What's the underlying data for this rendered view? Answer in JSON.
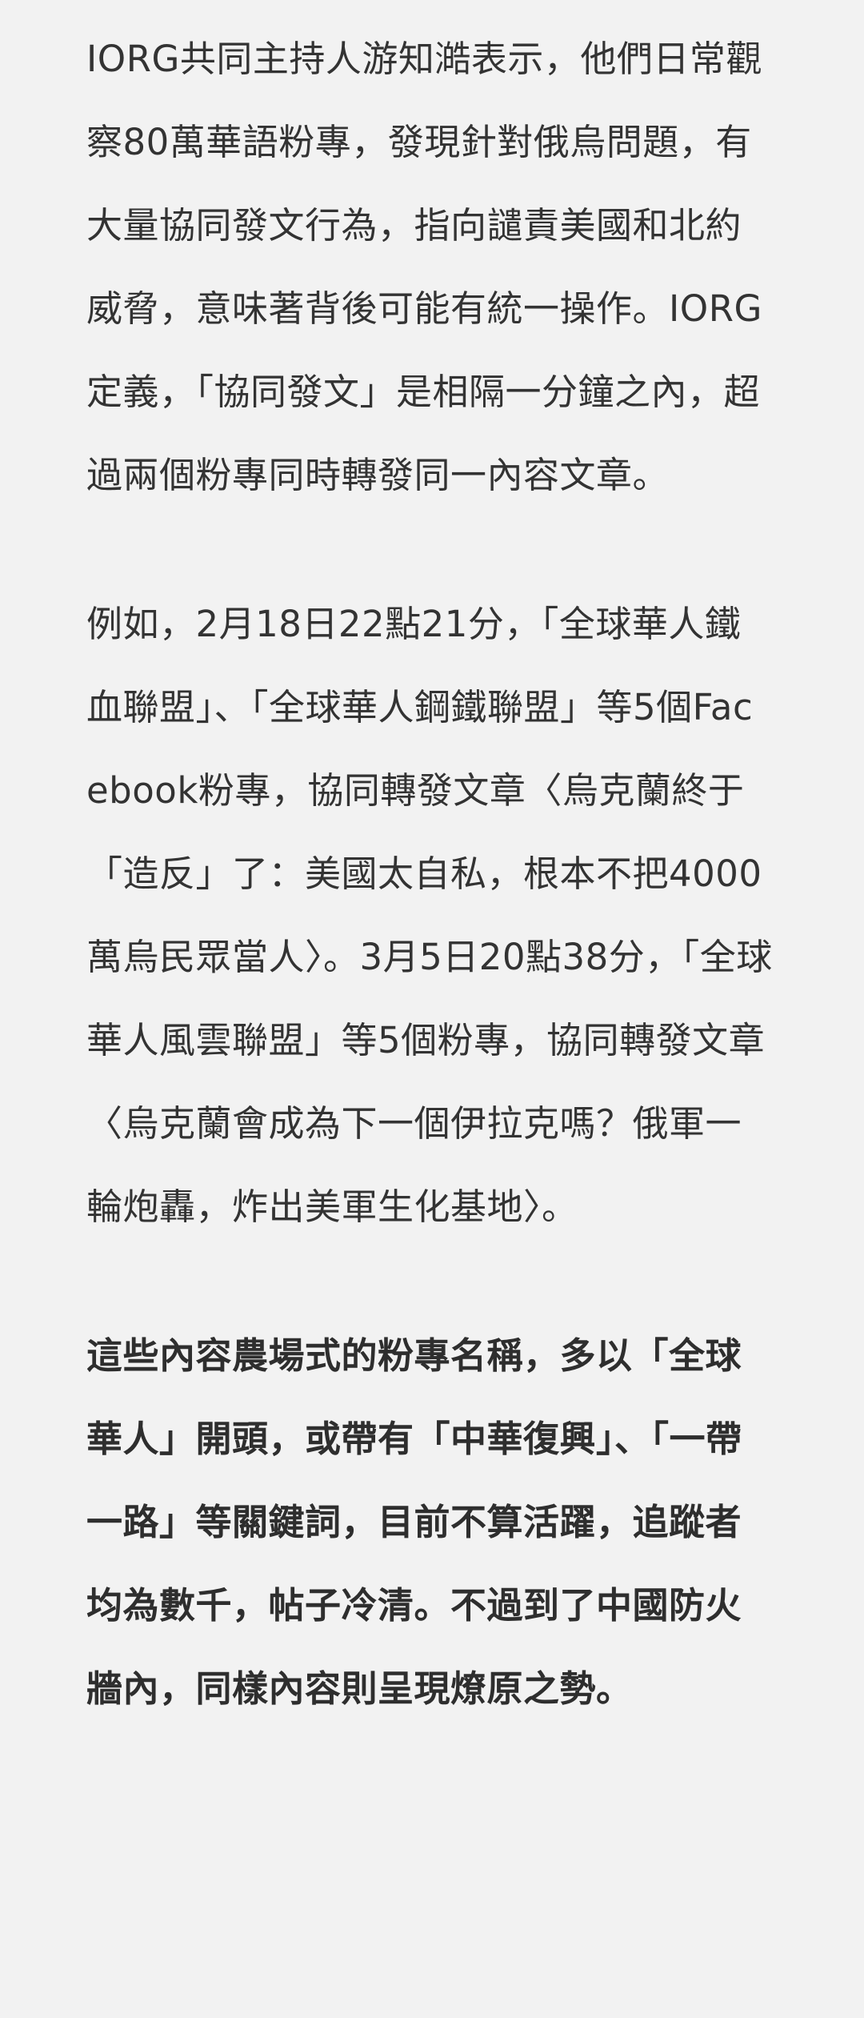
{
  "article": {
    "paragraphs": [
      {
        "text": "IORG共同主持人游知澔表示，他們日常觀察80萬華語粉專，發現針對俄烏問題，有大量協同發文行為，指向譴責美國和北約威脅，意味著背後可能有統一操作。IORG定義，「協同發文」是相隔一分鐘之內，超過兩個粉專同時轉發同一內容文章。"
      },
      {
        "text": "例如，2月18日22點21分，「全球華人鐵血聯盟」、「全球華人鋼鐵聯盟」等5個Facebook粉專，協同轉發文章〈烏克蘭終于「造反」了：美國太自私，根本不把4000萬烏民眾當人〉。3月5日20點38分，「全球華人風雲聯盟」等5個粉專，協同轉發文章〈烏克蘭會成為下一個伊拉克嗎？俄軍一輪炮轟，炸出美軍生化基地〉。"
      },
      {
        "text": "這些內容農場式的粉專名稱，多以「全球華人」開頭，或帶有「中華復興」、「一帶一路」等關鍵詞，目前不算活躍，追蹤者均為數千，帖子冷清。不過到了中國防火牆內，同樣內容則呈現燎原之勢。"
      }
    ]
  }
}
